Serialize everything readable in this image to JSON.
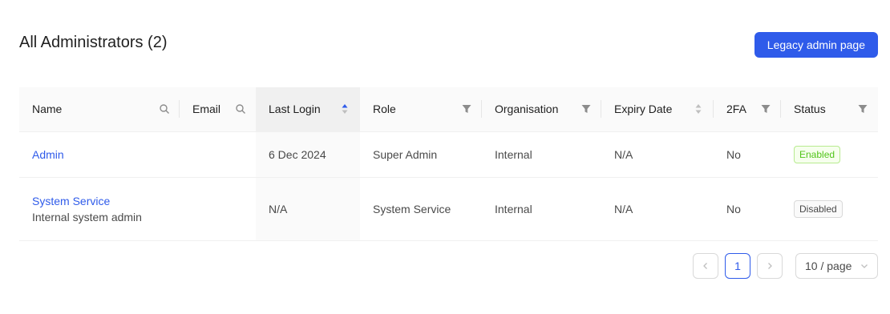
{
  "header": {
    "title": "All Administrators (2)",
    "legacy_button": "Legacy admin page"
  },
  "table": {
    "columns": [
      "Name",
      "Email",
      "Last Login",
      "Role",
      "Organisation",
      "Expiry Date",
      "2FA",
      "Status"
    ],
    "rows": [
      {
        "name": "Admin",
        "subtitle": "",
        "email": "",
        "last_login": "6 Dec 2024",
        "role": "Super Admin",
        "organisation": "Internal",
        "expiry_date": "N/A",
        "twofa": "No",
        "status": "Enabled"
      },
      {
        "name": "System Service",
        "subtitle": "Internal system admin",
        "email": "",
        "last_login": "N/A",
        "role": "System Service",
        "organisation": "Internal",
        "expiry_date": "N/A",
        "twofa": "No",
        "status": "Disabled"
      }
    ]
  },
  "pagination": {
    "current_page": "1",
    "page_size": "10 / page"
  },
  "colors": {
    "primary": "#2f5bea",
    "enabled": "#52c41a",
    "header_bg": "#fafafa"
  },
  "icons": {
    "name_col": "search-icon",
    "email_col": "search-icon",
    "last_login_col": "sort-icon",
    "role_col": "filter-icon",
    "organisation_col": "filter-icon",
    "expiry_col": "sort-icon",
    "twofa_col": "filter-icon",
    "status_col": "filter-icon"
  }
}
